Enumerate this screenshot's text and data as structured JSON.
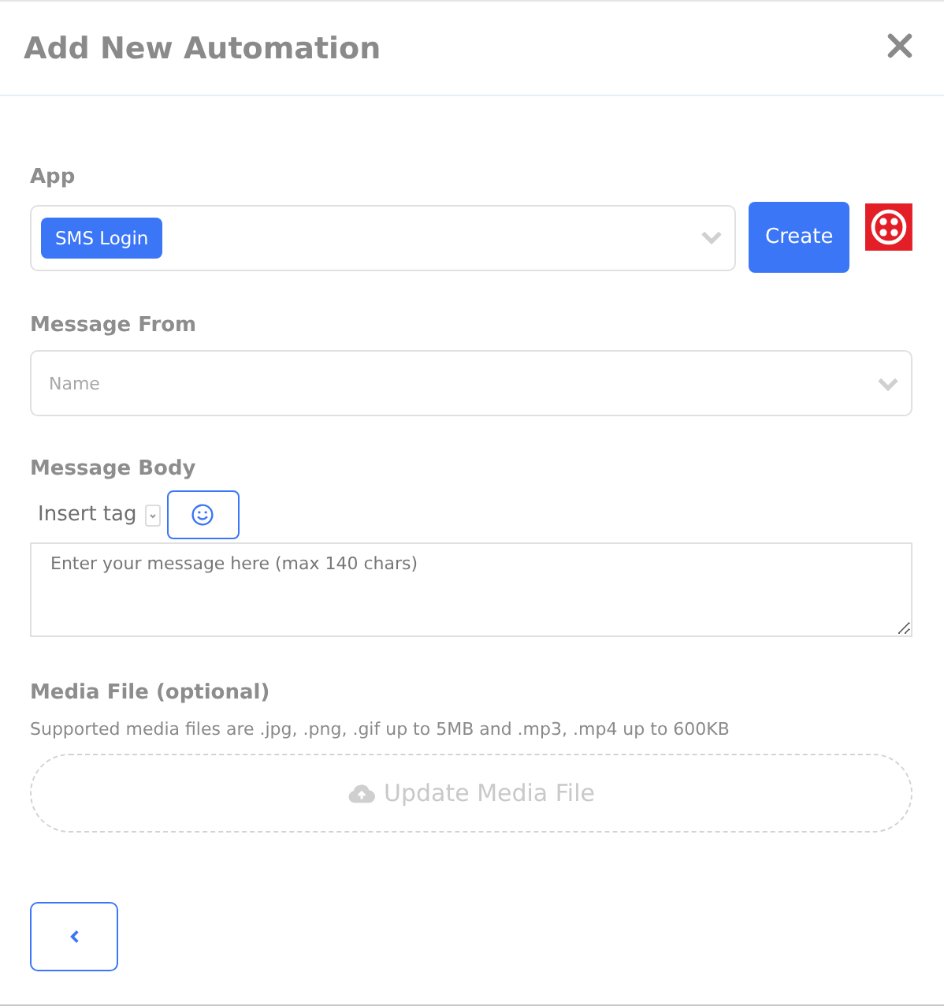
{
  "dialog": {
    "title": "Add New Automation"
  },
  "app": {
    "label": "App",
    "selected_tag": "SMS Login",
    "create_button": "Create"
  },
  "message_from": {
    "label": "Message From",
    "placeholder": "Name"
  },
  "message_body": {
    "label": "Message Body",
    "insert_tag": "Insert tag",
    "placeholder": "Enter your message here (max 140 chars)"
  },
  "media": {
    "label": "Media File (optional)",
    "help": "Supported media files are .jpg, .png, .gif up to 5MB and .mp3, .mp4 up to 600KB",
    "upload_button": "Update Media File"
  }
}
